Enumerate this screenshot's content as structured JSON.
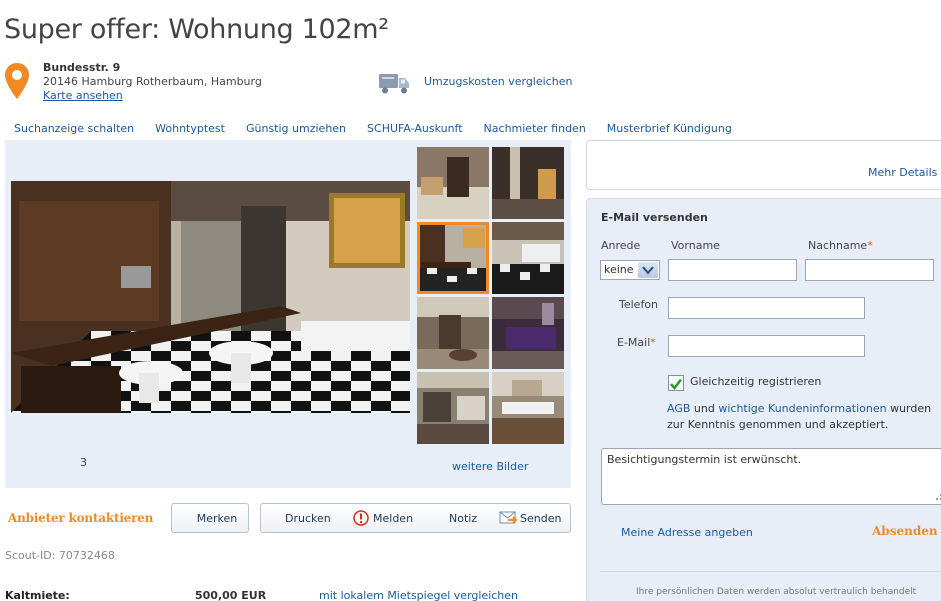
{
  "title": "Super offer: Wohnung 102m²",
  "address": {
    "street": "Bundesstr. 9",
    "city": "20146 Hamburg Rotherbaum, Hamburg",
    "map_link": "Karte ansehen"
  },
  "moving": {
    "link": "Umzugskosten vergleichen",
    "icon": "truck-icon"
  },
  "nav": [
    "Suchanzeige schalten",
    "Wohntyptest",
    "Günstig umziehen",
    "SCHUFA-Auskunft",
    "Nachmieter finden",
    "Musterbrief Kündigung"
  ],
  "gallery": {
    "counter": "3",
    "more_link": "weitere Bilder",
    "thumbnails": 8,
    "selected_thumbnail": 3
  },
  "actions": {
    "contact": "Anbieter kontaktieren",
    "merken": "Merken",
    "drucken": "Drucken",
    "melden": "Melden",
    "notiz": "Notiz",
    "senden": "Senden"
  },
  "scout_id": "Scout-ID: 70732468",
  "rent": {
    "label": "Kaltmiete:",
    "value": "500,00 EUR",
    "link": "mit lokalem Mietspiegel vergleichen"
  },
  "details_link": "Mehr Details",
  "email_form": {
    "title": "E-Mail versenden",
    "anrede_label": "Anrede",
    "anrede_value": "keine",
    "vorname_label": "Vorname",
    "nachname_label": "Nachname",
    "telefon_label": "Telefon",
    "email_label": "E-Mail",
    "register_label": "Gleichzeitig registrieren",
    "register_checked": true,
    "agb": "AGB",
    "und": "und",
    "kundeninfo": "wichtige Kundeninformationen",
    "wurden": "wurden",
    "accepted": "zur Kenntnis genommen und akzeptiert.",
    "message": "Besichtigungstermin ist erwünscht.",
    "address_link": "Meine Adresse angeben",
    "send": "Absenden",
    "privacy": "Ihre persönlichen Daten werden absolut vertraulich behandelt"
  },
  "colors": {
    "accent": "#f08a24",
    "link": "#1a5a9a",
    "panel": "#e8eef8"
  }
}
